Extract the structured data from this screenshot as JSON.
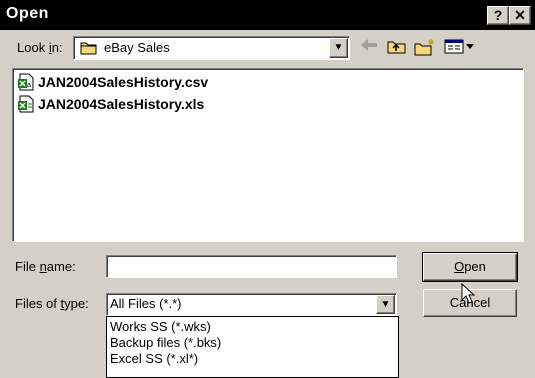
{
  "window": {
    "title": "Open",
    "help_glyph": "?",
    "close_glyph": "✕"
  },
  "lookin": {
    "label_pre": "Look ",
    "label_key": "i",
    "label_post": "n:",
    "value": "eBay Sales",
    "folder_icon": "folder-icon",
    "toolbar_icons": [
      "back-arrow-icon",
      "up-folder-icon",
      "new-folder-icon",
      "view-menu-icon"
    ]
  },
  "files": [
    {
      "name": "JAN2004SalesHistory.csv",
      "icon": "csv-file-icon"
    },
    {
      "name": "JAN2004SalesHistory.xls",
      "icon": "excel-file-icon"
    }
  ],
  "filename": {
    "label_pre": "File ",
    "label_key": "n",
    "label_post": "ame:",
    "value": ""
  },
  "filetype": {
    "label_pre": "Files of ",
    "label_key": "t",
    "label_post": "ype:",
    "value": "All Files (*.*)",
    "options": [
      "Works SS (*.wks)",
      "Backup files (*.bks)",
      "Excel SS (*.xl*)"
    ]
  },
  "buttons": {
    "open_key": "O",
    "open_rest": "pen",
    "cancel": "Cancel"
  },
  "colors": {
    "face": "#d4d0c8",
    "titlebar": "#000000",
    "excel_green": "#1f7a1f"
  }
}
